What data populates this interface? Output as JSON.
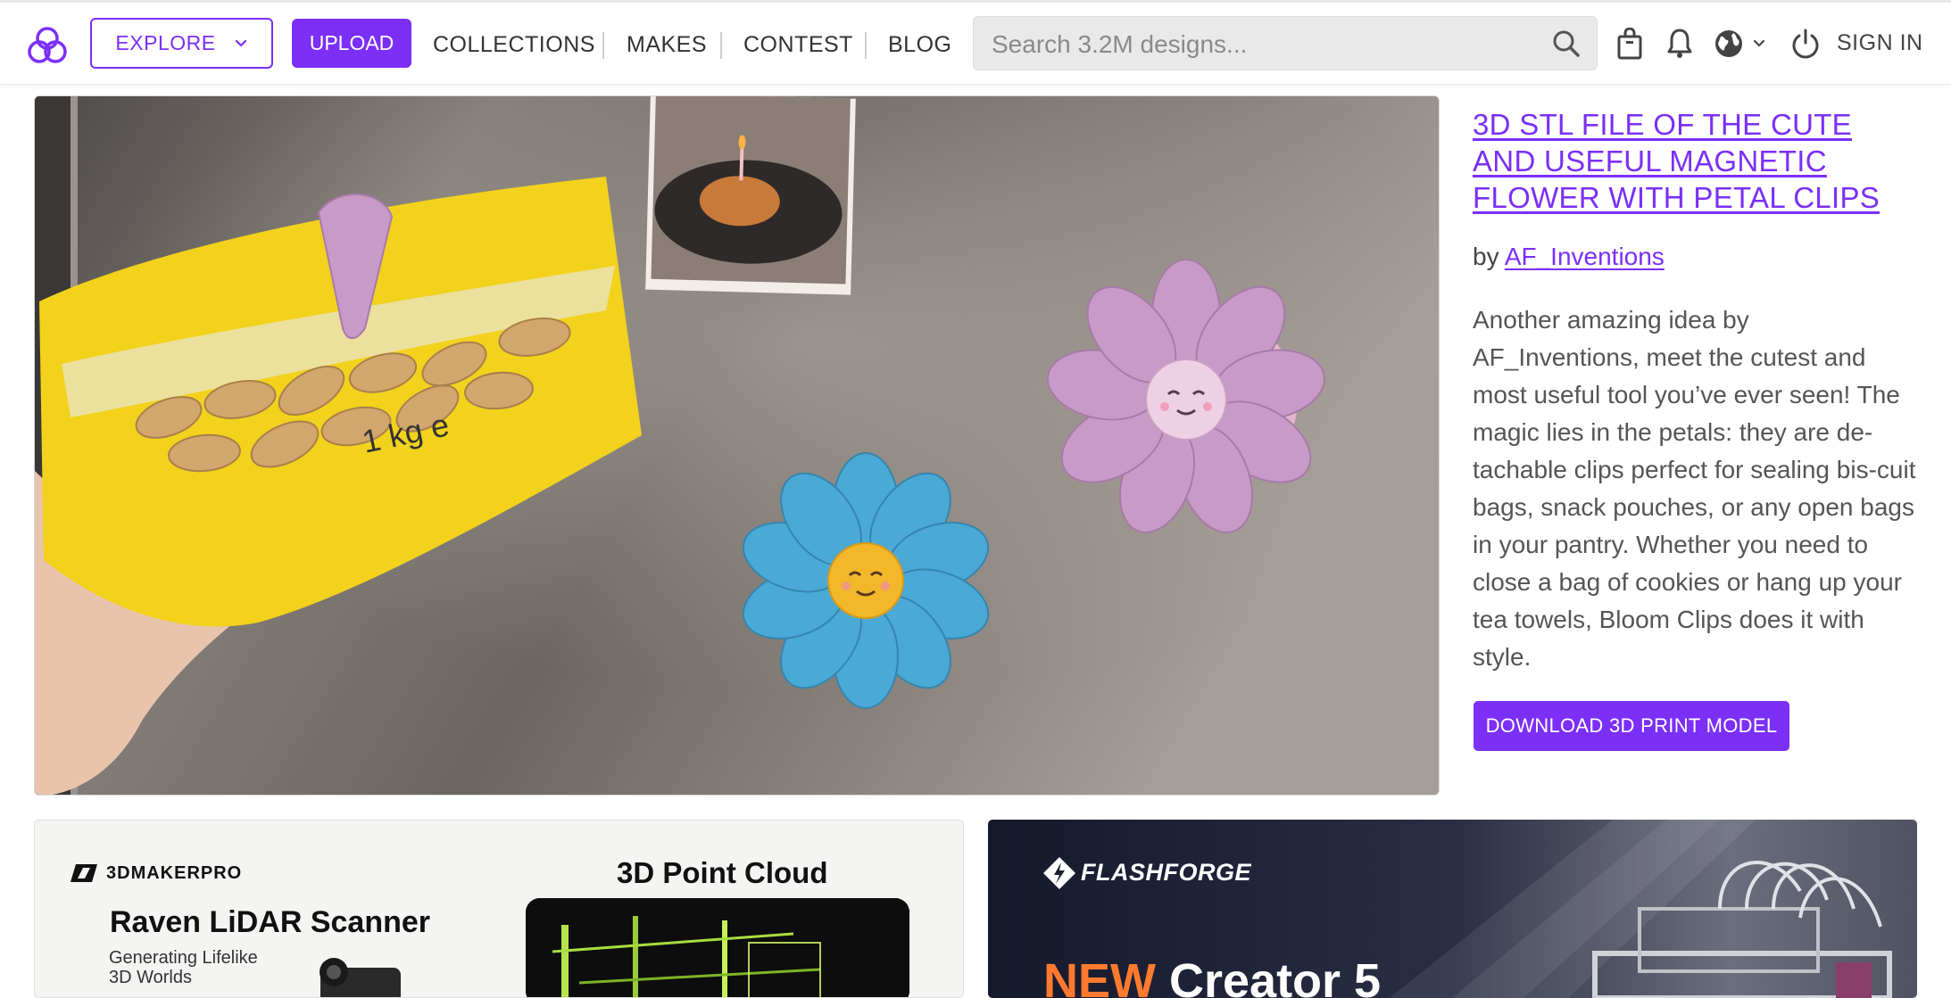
{
  "header": {
    "explore_label": "EXPLORE",
    "upload_label": "UPLOAD",
    "nav": [
      "COLLECTIONS",
      "MAKES",
      "CONTEST",
      "BLOG"
    ],
    "search_placeholder": "Search 3.2M designs...",
    "signin_label": "SIGN IN",
    "icons": [
      "cults-logo-icon",
      "chevron-down-icon",
      "search-icon",
      "shopping-bag-icon",
      "bell-icon",
      "globe-icon",
      "power-icon"
    ]
  },
  "hero": {
    "title": "3D STL file of the cute and useful magnetic flower with petal clips",
    "by_prefix": "by",
    "author": "AF_Inventions",
    "description": "Another amazing idea by AF_Inventions, meet the cutest and most useful tool you’ve ever seen! The magic lies in the petals: they are de-tachable clips perfect for sealing bis-cuit bags, snack pouches, or any open bags in your pantry. Whether you need to close a bag of cookies or hang up your tea towels, Bloom Clips does it with style.",
    "download_label": "DOWNLOAD 3D PRINT MODEL",
    "bag_label": "1 kg e"
  },
  "banners": {
    "left": {
      "brand": "3DMAKERPRO",
      "title": "Raven LiDAR Scanner",
      "subtitle": "Generating Lifelike 3D Worlds",
      "right_title": "3D Point Cloud"
    },
    "right": {
      "brand": "FLASHFORGE",
      "headline_accent": "NEW",
      "headline": "Creator 5"
    }
  },
  "colors": {
    "accent": "#7b2ff7",
    "text": "#555555",
    "flower_pink": "#c89ac8",
    "flower_blue": "#4ba9d6",
    "bag_yellow": "#f2d21c"
  }
}
